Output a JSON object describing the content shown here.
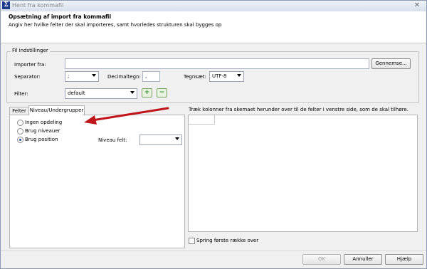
{
  "window": {
    "title": "Hent fra kommafil",
    "app_icon": "sigma-icon",
    "close_glyph": "✕"
  },
  "header": {
    "title": "Opsætning af import fra kommafil",
    "subtitle": "Angiv her hvilke felter der skal importeres, samt hvorledes strukturen skal bygges op"
  },
  "file_settings": {
    "group_label": "Fil indstillinger",
    "import_label": "Importer fra:",
    "import_value": "",
    "browse_label": "Gennemse...",
    "separator_label": "Separator:",
    "separator_value": ";",
    "decimal_label": "Decimaltegn:",
    "decimal_value": ",",
    "charset_label": "Tegnsæt:",
    "charset_value": "UTF-8",
    "filter_label": "Filter:",
    "filter_value": "default",
    "add_glyph": "+",
    "remove_glyph": "−"
  },
  "tabs": [
    {
      "label": "Felter",
      "active": false
    },
    {
      "label": "Niveau/Undergrupper",
      "active": true
    }
  ],
  "level_options": {
    "radios": [
      {
        "label": "Ingen opdeling",
        "selected": false
      },
      {
        "label": "Brug niveauer",
        "selected": false
      },
      {
        "label": "Brug position",
        "selected": true
      }
    ],
    "level_field_label": "Niveau felt:",
    "level_field_value": ""
  },
  "right_panel": {
    "instruction": "Træk kolonner fra skemaet herunder over til de felter i venstre side, som de skal tilhøre.",
    "skip_first_row_label": "Spring første række over",
    "skip_first_row_checked": false
  },
  "footer": {
    "ok_label": "OK",
    "cancel_label": "Annuller",
    "help_label": "Hjælp"
  },
  "colors": {
    "arrow": "#c0161b",
    "accent": "#1f4fa0"
  }
}
